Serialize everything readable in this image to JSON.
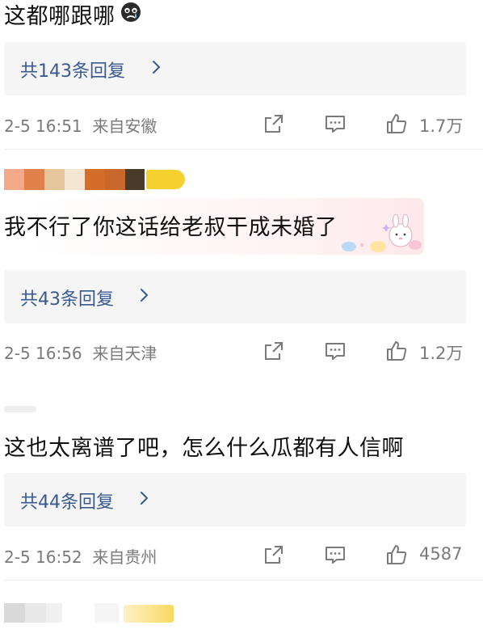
{
  "comments": [
    {
      "text": "这都哪跟哪",
      "reply_label": "共143条回复",
      "time": "2-5 16:51",
      "location": "来自安徽",
      "likes": "1.7万"
    },
    {
      "text": "我不行了你这话给老叔干成未婚了",
      "reply_label": "共43条回复",
      "time": "2-5 16:56",
      "location": "来自天津",
      "likes": "1.2万"
    },
    {
      "text": "这也太离谱了吧，怎么什么瓜都有人信啊",
      "reply_label": "共44条回复",
      "time": "2-5 16:52",
      "location": "来自贵州",
      "likes": "4587"
    }
  ],
  "icons": {
    "share": "share-icon",
    "comment": "comment-icon",
    "like": "thumbs-up-icon",
    "chevron": "chevron-right-icon",
    "emoji": "crying-emoji-icon"
  },
  "colors": {
    "reply_link": "#3a5a8f",
    "meta_gray": "#7a7a7a",
    "reply_bg": "#f5f5f5"
  }
}
